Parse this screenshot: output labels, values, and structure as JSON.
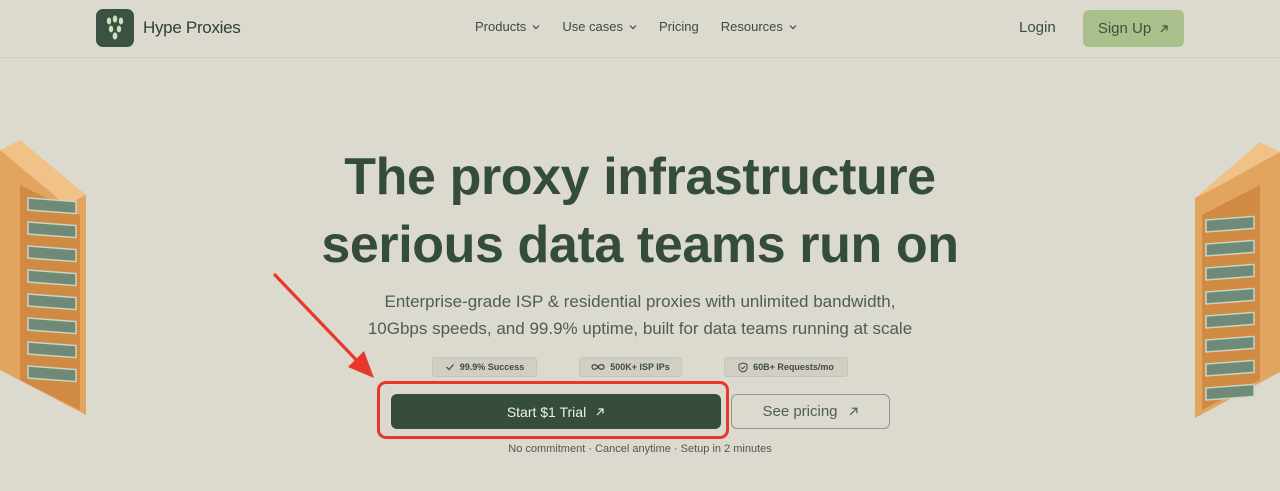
{
  "nav": {
    "logo_text": "Hype Proxies",
    "menu": [
      {
        "label": "Products",
        "has_dropdown": true
      },
      {
        "label": "Use cases",
        "has_dropdown": true
      },
      {
        "label": "Pricing",
        "has_dropdown": false
      },
      {
        "label": "Resources",
        "has_dropdown": true
      }
    ],
    "login_label": "Login",
    "signup_label": "Sign Up"
  },
  "hero": {
    "title_line1": "The proxy infrastructure",
    "title_line2": "serious data teams run on",
    "subtitle_line1": "Enterprise-grade ISP & residential proxies with unlimited bandwidth,",
    "subtitle_line2": "10Gbps speeds, and 99.9% uptime, built for data teams running at scale",
    "badges": [
      {
        "icon": "check-icon",
        "label": "99.9% Success"
      },
      {
        "icon": "infinity-icon",
        "label": "500K+ ISP IPs"
      },
      {
        "icon": "shield-check-icon",
        "label": "60B+ Requests/mo"
      }
    ],
    "primary_cta": "Start $1 Trial",
    "secondary_cta": "See pricing",
    "fine_print": "No commitment · Cancel anytime · Setup in 2 minutes"
  },
  "colors": {
    "background": "#dcd9ce",
    "primary": "#364d3d",
    "accent": "#a9c08d",
    "annotation": "#e8372b"
  }
}
